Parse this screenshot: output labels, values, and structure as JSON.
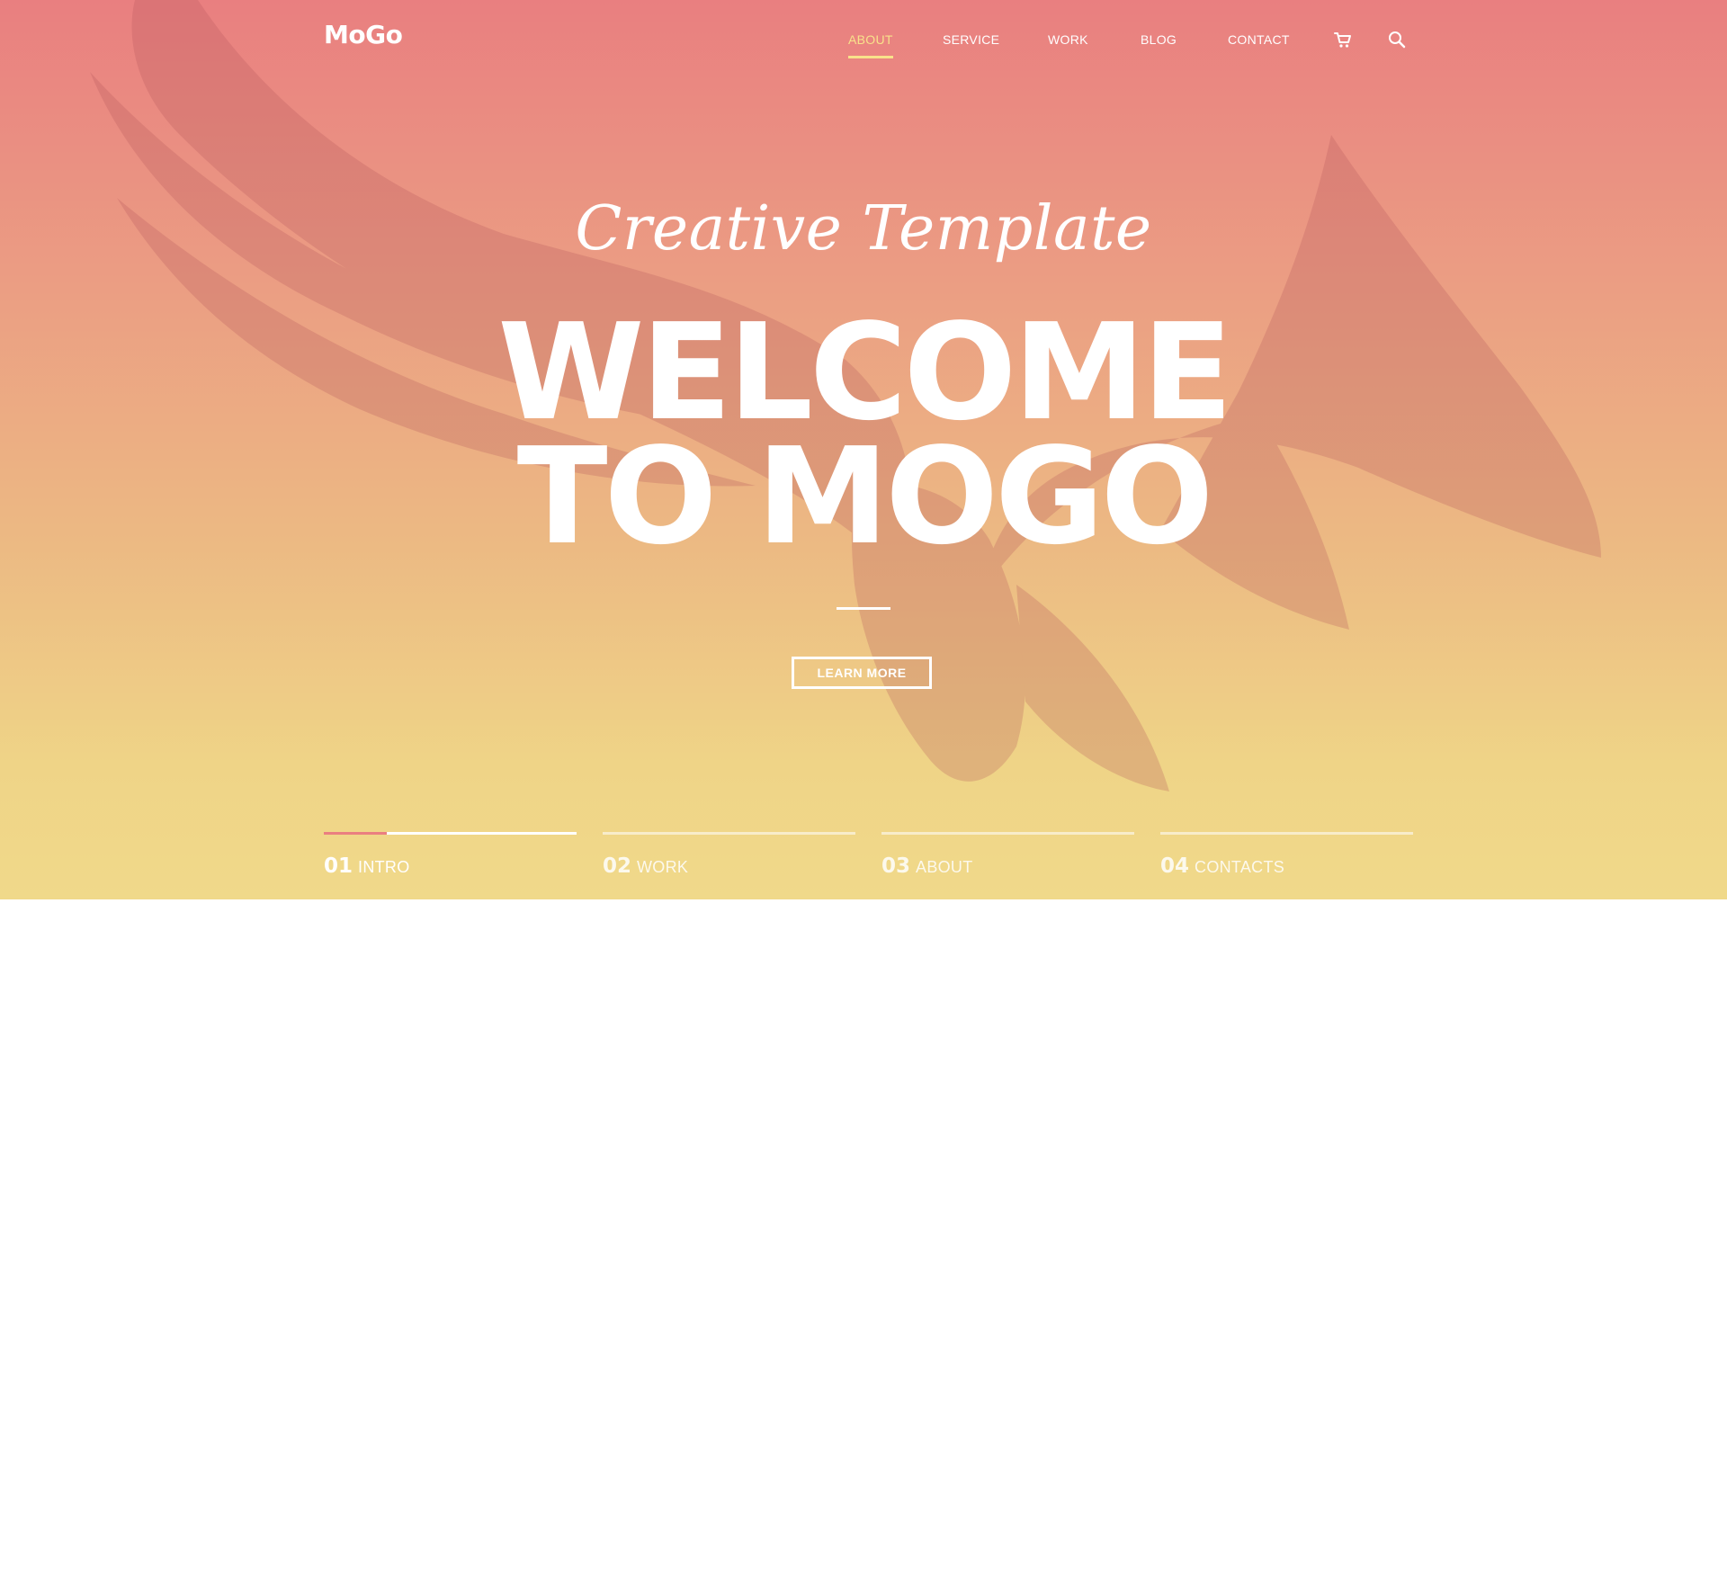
{
  "brand": {
    "logo": "MoGo"
  },
  "nav": {
    "items": [
      {
        "label": "ABOUT",
        "active": true
      },
      {
        "label": "SERVICE",
        "active": false
      },
      {
        "label": "WORK",
        "active": false
      },
      {
        "label": "BLOG",
        "active": false
      },
      {
        "label": "CONTACT",
        "active": false
      }
    ],
    "icons": [
      "cart-icon",
      "search-icon"
    ]
  },
  "hero": {
    "script_title": "Creative Template",
    "headline_line1": "WELCOME",
    "headline_line2": "TO MOGO",
    "button_label": "LEARN MORE"
  },
  "steps": [
    {
      "number": "01",
      "label": "INTRO",
      "active": true,
      "progress": 0.25
    },
    {
      "number": "02",
      "label": "WORK",
      "active": false,
      "progress": 0
    },
    {
      "number": "03",
      "label": "ABOUT",
      "active": false,
      "progress": 0
    },
    {
      "number": "04",
      "label": "CONTACTS",
      "active": false,
      "progress": 0
    }
  ],
  "colors": {
    "gradient_top": "#e97f80",
    "gradient_bottom": "#f0d98a",
    "nav_active": "#f8e28a",
    "step_progress": "#ea7f80",
    "page_background": "#ffffff"
  }
}
